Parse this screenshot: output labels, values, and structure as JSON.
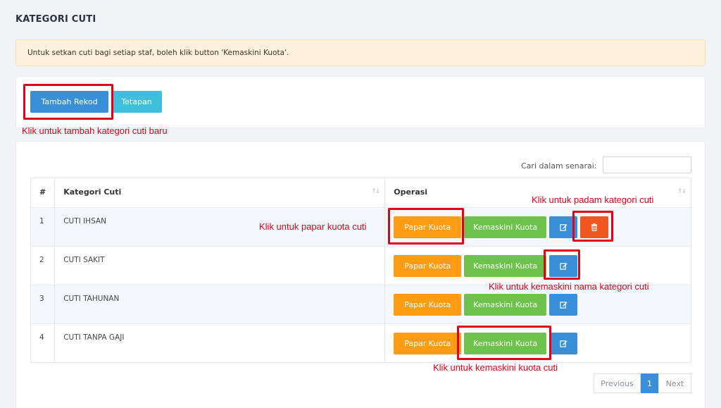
{
  "page": {
    "title": "KATEGORI CUTI",
    "alert": "Untuk setkan cuti bagi setiap staf, boleh klik button 'Kemaskini Kuota'."
  },
  "toolbar": {
    "add_label": "Tambah Rekod",
    "settings_label": "Tetapan"
  },
  "table": {
    "search_label": "Cari dalam senarai:",
    "headers": [
      "#",
      "Kategori Cuti",
      "Operasi"
    ],
    "rows": [
      {
        "num": "1",
        "category": "CUTI IHSAN",
        "has_delete": true
      },
      {
        "num": "2",
        "category": "CUTI SAKIT",
        "has_delete": false
      },
      {
        "num": "3",
        "category": "CUTI TAHUNAN",
        "has_delete": false
      },
      {
        "num": "4",
        "category": "CUTI TANPA GAJI",
        "has_delete": false
      }
    ],
    "actions": {
      "view_quota": "Papar Kuota",
      "edit_quota": "Kemaskini Kuota"
    }
  },
  "pagination": {
    "previous": "Previous",
    "current": "1",
    "next": "Next"
  },
  "annotations": {
    "add": "Klik untuk tambah kategori cuti baru",
    "delete": "Klik untuk padam kategori cuti",
    "view": "Klik untuk papar kuota cuti",
    "edit_name": "Klik untuk kemaskini nama kategori cuti",
    "edit_quota": "Klik untuk kemaskini kuota cuti"
  },
  "colors": {
    "primary": "#3a8fd9",
    "orange": "#ff9c14",
    "green": "#6cc24a",
    "red": "#f0561f",
    "annotation": "#e3001b"
  },
  "icons": {
    "edit": "edit-icon",
    "delete": "trash-icon",
    "sort": "sort-icon"
  }
}
